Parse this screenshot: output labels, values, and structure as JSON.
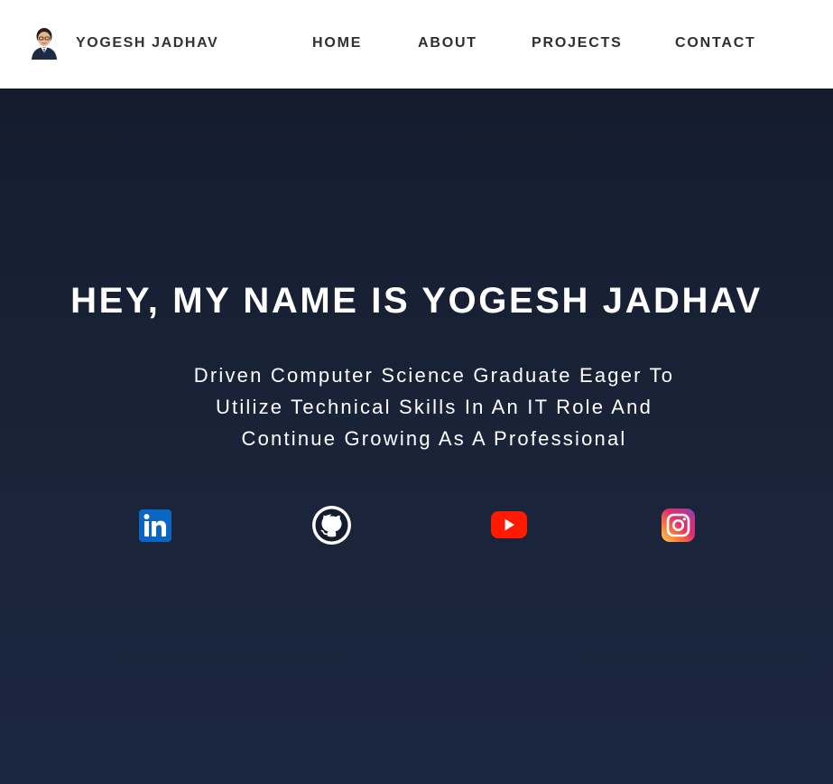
{
  "header": {
    "brand_name": "YOGESH JADHAV",
    "nav": {
      "home": "HOME",
      "about": "ABOUT",
      "projects": "PROJECTS",
      "contact": "CONTACT"
    }
  },
  "hero": {
    "title": "HEY, MY NAME IS YOGESH JADHAV",
    "subtitle_lines": [
      "Driven Computer Science Graduate Eager To",
      "Utilize Technical Skills In An IT Role And",
      "Continue Growing As A Professional"
    ]
  },
  "social_links": [
    {
      "name": "linkedin-icon"
    },
    {
      "name": "github-icon"
    },
    {
      "name": "youtube-icon"
    },
    {
      "name": "instagram-icon"
    }
  ],
  "colors": {
    "hero_bg": "#172033",
    "linkedin_blue": "#0a66c2",
    "youtube_red": "#ff0000",
    "nav_text": "#333333"
  }
}
